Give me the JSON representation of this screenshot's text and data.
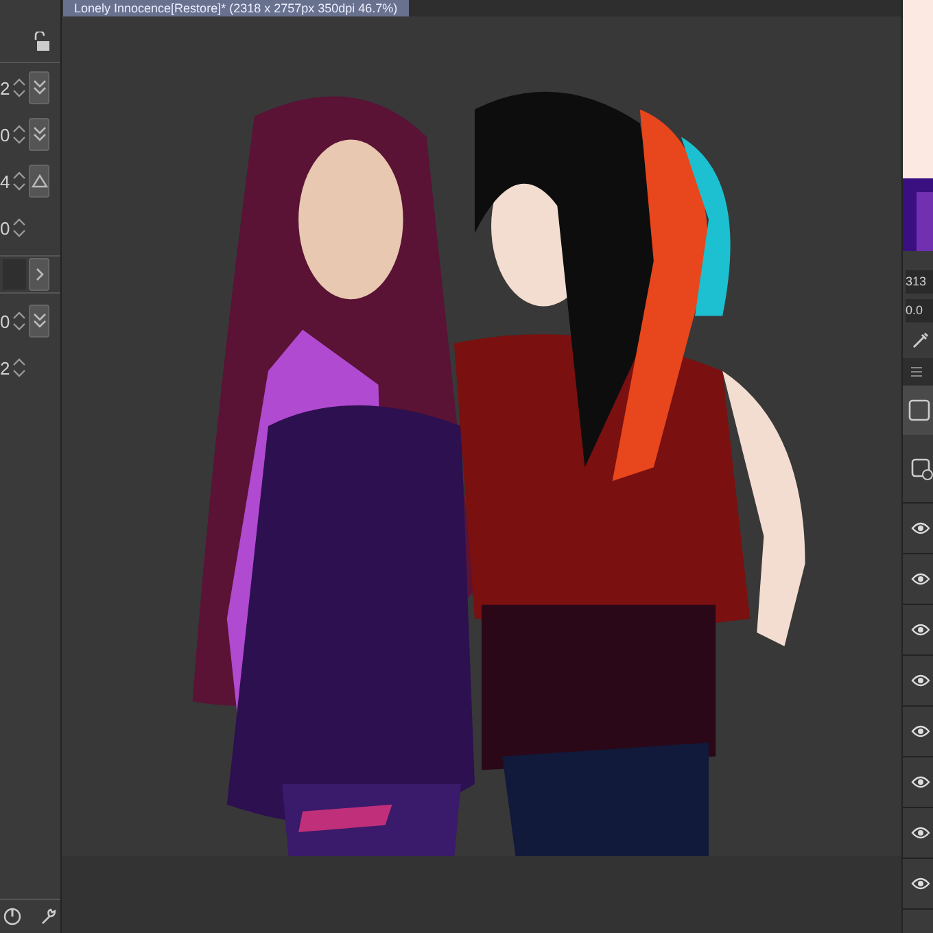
{
  "document_tab": {
    "title": "Lonely Innocence[Restore]* (2318 x 2757px 350dpi 46.7%)"
  },
  "tool_property": {
    "rows": [
      {
        "kind": "check",
        "value": "2"
      },
      {
        "kind": "check",
        "value": "0"
      },
      {
        "kind": "triangle",
        "value": "4"
      },
      {
        "kind": "plain",
        "value": "0"
      },
      {
        "kind": "arrow"
      },
      {
        "kind": "check",
        "value": "0"
      },
      {
        "kind": "plain",
        "value": "2"
      }
    ]
  },
  "fields": [
    "313",
    "0.0"
  ],
  "layers": [
    {
      "visible": true
    },
    {
      "visible": true
    },
    {
      "visible": true
    },
    {
      "visible": true
    },
    {
      "visible": true
    },
    {
      "visible": true
    },
    {
      "visible": true
    },
    {
      "visible": true
    }
  ]
}
